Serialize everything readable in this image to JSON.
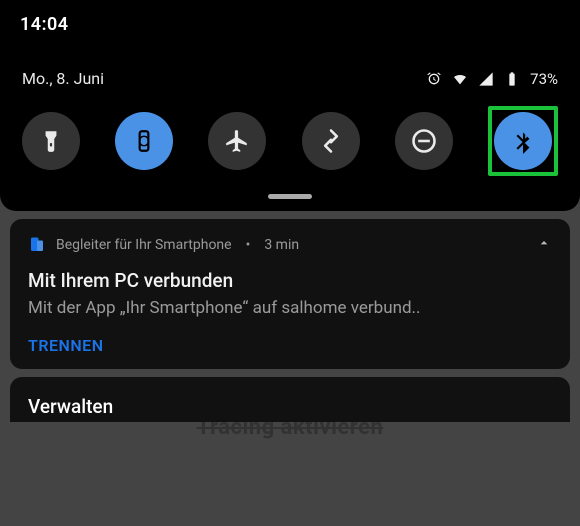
{
  "status_bar": {
    "time": "14:04"
  },
  "quick_settings": {
    "date": "Mo., 8. Juni",
    "battery_pct": "73%",
    "tiles": [
      {
        "name": "flashlight",
        "active": false
      },
      {
        "name": "screen-rotation",
        "active": true
      },
      {
        "name": "airplane-mode",
        "active": false
      },
      {
        "name": "sync",
        "active": false
      },
      {
        "name": "do-not-disturb",
        "active": false
      },
      {
        "name": "bluetooth",
        "active": true,
        "highlighted": true
      }
    ]
  },
  "notification": {
    "app_name": "Begleiter für Ihr Smartphone",
    "age": "3 min",
    "title": "Mit Ihrem PC verbunden",
    "body": "Mit der App „Ihr Smartphone“ auf salhome verbund..",
    "action": "TRENNEN"
  },
  "background_hint": "Tracing aktivieren",
  "manage_label": "Verwalten"
}
